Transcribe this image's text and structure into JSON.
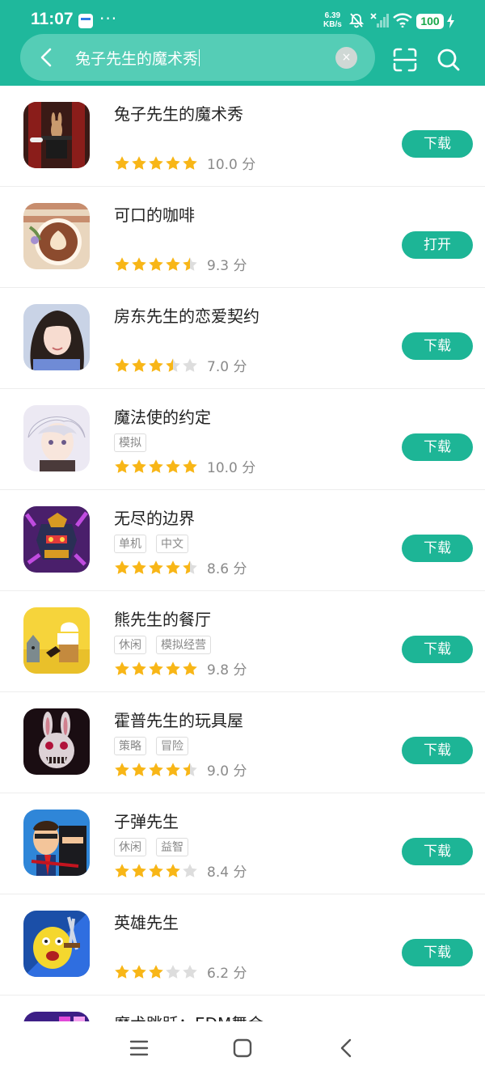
{
  "status_bar": {
    "time": "11:07",
    "dots": "···",
    "speed_value": "6.39",
    "speed_unit": "KB/s",
    "battery": "100"
  },
  "search": {
    "query": "兔子先生的魔术秀",
    "clear_glyph": "×"
  },
  "colors": {
    "header": "#1fb89c",
    "search_box": "#55cdb6",
    "button": "#1db596",
    "star": "#f8b617",
    "star_empty": "#dddddd"
  },
  "apps": [
    {
      "name": "兔子先生的魔术秀",
      "tags": [],
      "stars": 5,
      "score": "10.0 分",
      "action": "下载"
    },
    {
      "name": "可口的咖啡",
      "tags": [],
      "stars": 4.5,
      "score": "9.3 分",
      "action": "打开"
    },
    {
      "name": "房东先生的恋爱契约",
      "tags": [],
      "stars": 3.5,
      "score": "7.0 分",
      "action": "下载"
    },
    {
      "name": "魔法使的约定",
      "tags": [
        "模拟"
      ],
      "stars": 5,
      "score": "10.0 分",
      "action": "下载"
    },
    {
      "name": "无尽的边界",
      "tags": [
        "单机",
        "中文"
      ],
      "stars": 4.5,
      "score": "8.6 分",
      "action": "下载"
    },
    {
      "name": "熊先生的餐厅",
      "tags": [
        "休闲",
        "模拟经营"
      ],
      "stars": 5,
      "score": "9.8 分",
      "action": "下载"
    },
    {
      "name": "霍普先生的玩具屋",
      "tags": [
        "策略",
        "冒险"
      ],
      "stars": 4.5,
      "score": "9.0 分",
      "action": "下载"
    },
    {
      "name": "子弹先生",
      "tags": [
        "休闲",
        "益智"
      ],
      "stars": 4,
      "score": "8.4 分",
      "action": "下载"
    },
    {
      "name": "英雄先生",
      "tags": [],
      "stars": 3,
      "score": "6.2 分",
      "action": "下载"
    },
    {
      "name": "魔术跳跃：EDM舞会",
      "tags": [],
      "stars": 0,
      "score": "",
      "action": ""
    }
  ]
}
